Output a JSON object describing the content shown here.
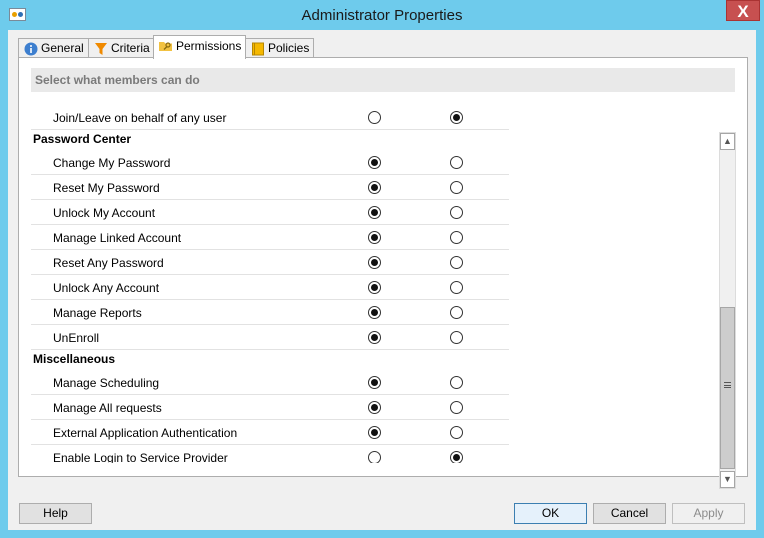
{
  "window": {
    "title": "Administrator Properties",
    "close_glyph": "X"
  },
  "tabs": [
    {
      "label": "General",
      "icon": "info-icon"
    },
    {
      "label": "Criteria",
      "icon": "funnel-icon"
    },
    {
      "label": "Permissions",
      "icon": "folder-key-icon",
      "active": true
    },
    {
      "label": "Policies",
      "icon": "policy-book-icon"
    }
  ],
  "section_header": "Select what members can do",
  "rows": [
    {
      "kind": "perm",
      "label": "Join/Leave on behalf of any user",
      "col1": false,
      "col2": true
    },
    {
      "kind": "group",
      "label": "Password Center"
    },
    {
      "kind": "perm",
      "label": "Change My Password",
      "col1": true,
      "col2": false
    },
    {
      "kind": "perm",
      "label": "Reset My Password",
      "col1": true,
      "col2": false
    },
    {
      "kind": "perm",
      "label": "Unlock My Account",
      "col1": true,
      "col2": false
    },
    {
      "kind": "perm",
      "label": "Manage Linked Account",
      "col1": true,
      "col2": false
    },
    {
      "kind": "perm",
      "label": "Reset Any Password",
      "col1": true,
      "col2": false
    },
    {
      "kind": "perm",
      "label": "Unlock Any Account",
      "col1": true,
      "col2": false
    },
    {
      "kind": "perm",
      "label": "Manage Reports",
      "col1": true,
      "col2": false
    },
    {
      "kind": "perm",
      "label": "UnEnroll",
      "col1": true,
      "col2": false
    },
    {
      "kind": "group",
      "label": "Miscellaneous"
    },
    {
      "kind": "perm",
      "label": "Manage Scheduling",
      "col1": true,
      "col2": false
    },
    {
      "kind": "perm",
      "label": "Manage All requests",
      "col1": true,
      "col2": false
    },
    {
      "kind": "perm",
      "label": "External Application Authentication",
      "col1": true,
      "col2": false
    },
    {
      "kind": "perm",
      "label": "Enable Login to Service Provider",
      "col1": false,
      "col2": true
    }
  ],
  "buttons": {
    "help": "Help",
    "ok": "OK",
    "cancel": "Cancel",
    "apply": "Apply"
  },
  "colors": {
    "window_frame": "#6ecbec",
    "close_button": "#c75050",
    "default_button_border": "#3c7fb1"
  }
}
